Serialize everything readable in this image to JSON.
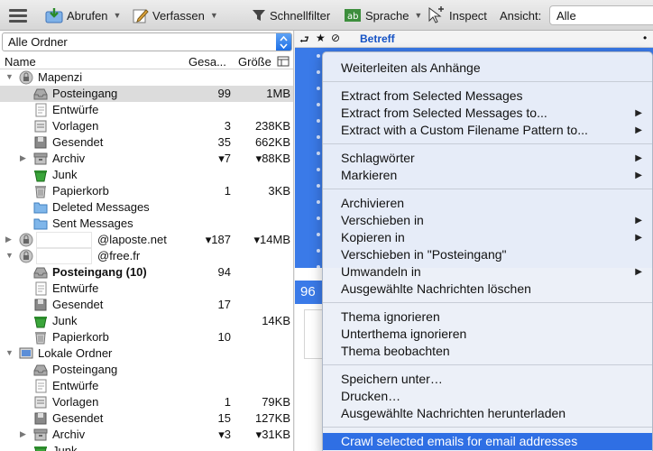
{
  "toolbar": {
    "get_messages": "Abrufen",
    "write": "Verfassen",
    "quick_filter": "Schnellfilter",
    "language": "Sprache",
    "inspect": "Inspect",
    "view_label": "Ansicht:",
    "view_value": "Alle"
  },
  "folder_pane": {
    "selector": "Alle Ordner",
    "columns": {
      "name": "Name",
      "total": "Gesa...",
      "size": "Größe"
    },
    "rows": [
      {
        "name": "Mapenzi",
        "total": "",
        "size": ""
      },
      {
        "name": "Posteingang",
        "total": "99",
        "size": "1MB"
      },
      {
        "name": "Entwürfe",
        "total": "",
        "size": ""
      },
      {
        "name": "Vorlagen",
        "total": "3",
        "size": "238KB"
      },
      {
        "name": "Gesendet",
        "total": "35",
        "size": "662KB"
      },
      {
        "name": "Archiv",
        "total": "▾7",
        "size": "▾88KB"
      },
      {
        "name": "Junk",
        "total": "",
        "size": ""
      },
      {
        "name": "Papierkorb",
        "total": "1",
        "size": "3KB"
      },
      {
        "name": "Deleted Messages",
        "total": "",
        "size": ""
      },
      {
        "name": "Sent Messages",
        "total": "",
        "size": ""
      },
      {
        "name": "@laposte.net",
        "total": "▾187",
        "size": "▾14MB"
      },
      {
        "name": "@free.fr",
        "total": "",
        "size": ""
      },
      {
        "name": "Posteingang (10)",
        "total": "94",
        "size": ""
      },
      {
        "name": "Entwürfe",
        "total": "",
        "size": ""
      },
      {
        "name": "Gesendet",
        "total": "17",
        "size": ""
      },
      {
        "name": "Junk",
        "total": "",
        "size": "14KB"
      },
      {
        "name": "Papierkorb",
        "total": "10",
        "size": ""
      },
      {
        "name": "Lokale Ordner",
        "total": "",
        "size": ""
      },
      {
        "name": "Posteingang",
        "total": "",
        "size": ""
      },
      {
        "name": "Entwürfe",
        "total": "",
        "size": ""
      },
      {
        "name": "Vorlagen",
        "total": "1",
        "size": "79KB"
      },
      {
        "name": "Gesendet",
        "total": "15",
        "size": "127KB"
      },
      {
        "name": "Archiv",
        "total": "▾3",
        "size": "▾31KB"
      },
      {
        "name": "Junk",
        "total": "",
        "size": ""
      }
    ]
  },
  "message_list": {
    "subject_header": "Betreff",
    "count": "96"
  },
  "context_menu": {
    "items": [
      "Weiterleiten als Anhänge",
      "Extract from Selected Messages",
      "Extract from Selected Messages to...",
      "Extract with a Custom Filename Pattern to...",
      "Schlagwörter",
      "Markieren",
      "Archivieren",
      "Verschieben in",
      "Kopieren in",
      "Verschieben in \"Posteingang\"",
      "Umwandeln in",
      "Ausgewählte Nachrichten löschen",
      "Thema ignorieren",
      "Unterthema ignorieren",
      "Thema beobachten",
      "Speichern unter…",
      "Drucken…",
      "Ausgewählte Nachrichten herunterladen",
      "Crawl selected emails for email addresses"
    ],
    "highlighted_index": 18,
    "highlight_color": "#2f6fe4"
  },
  "colors": {
    "selection_blue": "#3a7ae8",
    "subject_header_blue": "#1452c4"
  }
}
